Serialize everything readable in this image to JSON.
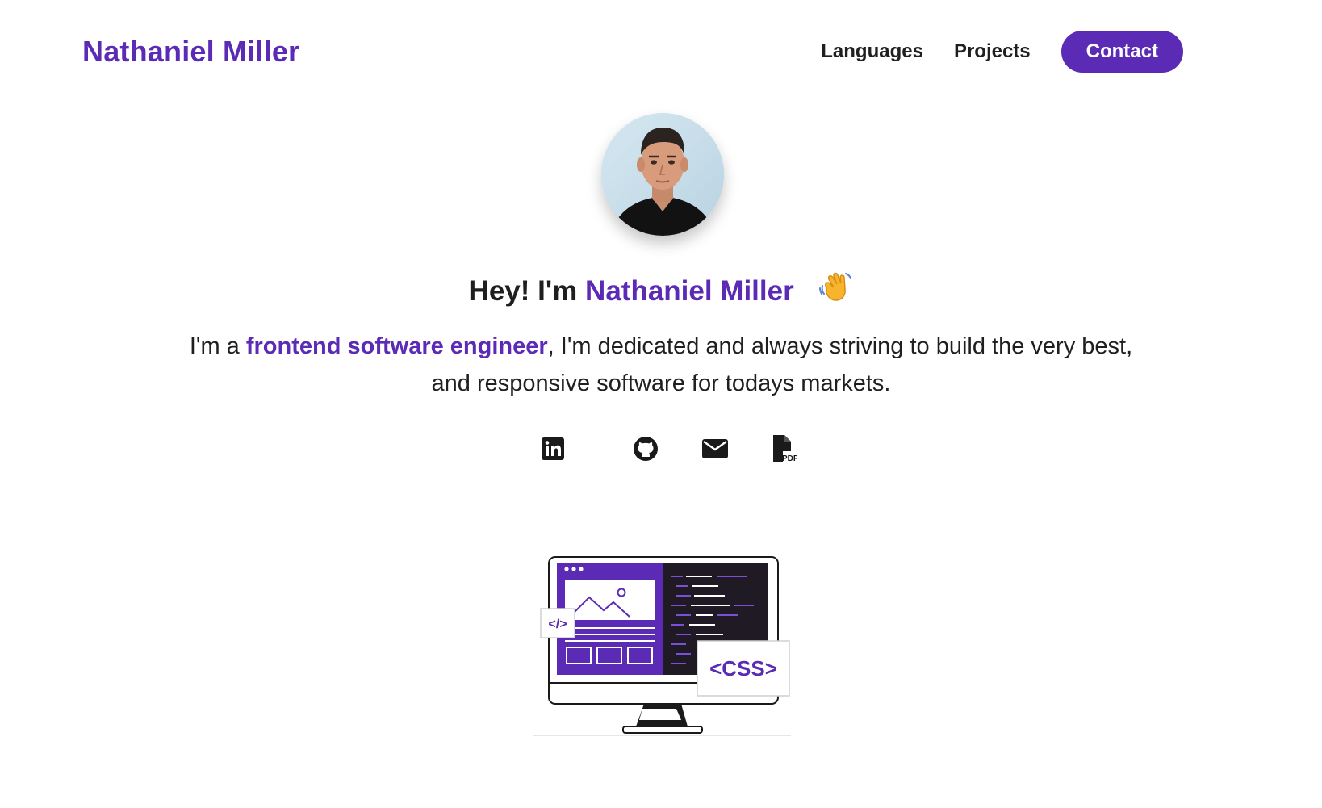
{
  "nav": {
    "brand": "Nathaniel Miller",
    "links": [
      "Languages",
      "Projects"
    ],
    "cta": "Contact"
  },
  "hero": {
    "greeting_prefix": "Hey! I'm",
    "greeting_name": "Nathaniel Miller",
    "greeting_emoji": "waving-hand-icon",
    "tagline_prefix": "I'm a",
    "tagline_highlight": "frontend software engineer",
    "tagline_rest": ", I'm dedicated and always striving to build the very best, and responsive software for todays markets."
  },
  "socials": [
    "linkedin-icon",
    "github-icon",
    "email-icon",
    "pdf-resume-icon"
  ],
  "illustration": {
    "code_badge": "</>",
    "css_badge": "<CSS>"
  },
  "colors": {
    "accent": "#5b2bb5",
    "text": "#1f1f1f",
    "background": "#ffffff"
  }
}
